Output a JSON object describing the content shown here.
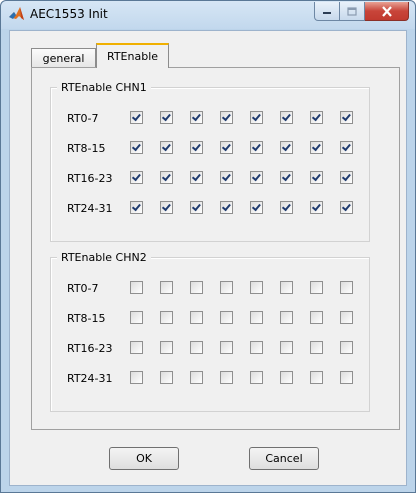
{
  "window": {
    "title": "AEC1553 Init"
  },
  "tabs": [
    {
      "label": "general",
      "active": false
    },
    {
      "label": "RTEnable",
      "active": true
    }
  ],
  "groups": [
    {
      "title": "RTEnable CHN1",
      "rows": [
        {
          "label": "RT0-7",
          "checks": [
            true,
            true,
            true,
            true,
            true,
            true,
            true,
            true
          ]
        },
        {
          "label": "RT8-15",
          "checks": [
            true,
            true,
            true,
            true,
            true,
            true,
            true,
            true
          ]
        },
        {
          "label": "RT16-23",
          "checks": [
            true,
            true,
            true,
            true,
            true,
            true,
            true,
            true
          ]
        },
        {
          "label": "RT24-31",
          "checks": [
            true,
            true,
            true,
            true,
            true,
            true,
            true,
            true
          ]
        }
      ]
    },
    {
      "title": "RTEnable CHN2",
      "rows": [
        {
          "label": "RT0-7",
          "checks": [
            false,
            false,
            false,
            false,
            false,
            false,
            false,
            false
          ]
        },
        {
          "label": "RT8-15",
          "checks": [
            false,
            false,
            false,
            false,
            false,
            false,
            false,
            false
          ]
        },
        {
          "label": "RT16-23",
          "checks": [
            false,
            false,
            false,
            false,
            false,
            false,
            false,
            false
          ]
        },
        {
          "label": "RT24-31",
          "checks": [
            false,
            false,
            false,
            false,
            false,
            false,
            false,
            false
          ]
        }
      ]
    }
  ],
  "buttons": {
    "ok": "OK",
    "cancel": "Cancel"
  },
  "icons": {
    "app": "matlab-icon",
    "minimize": "minimize-icon",
    "maximize": "maximize-icon",
    "close": "close-icon"
  }
}
